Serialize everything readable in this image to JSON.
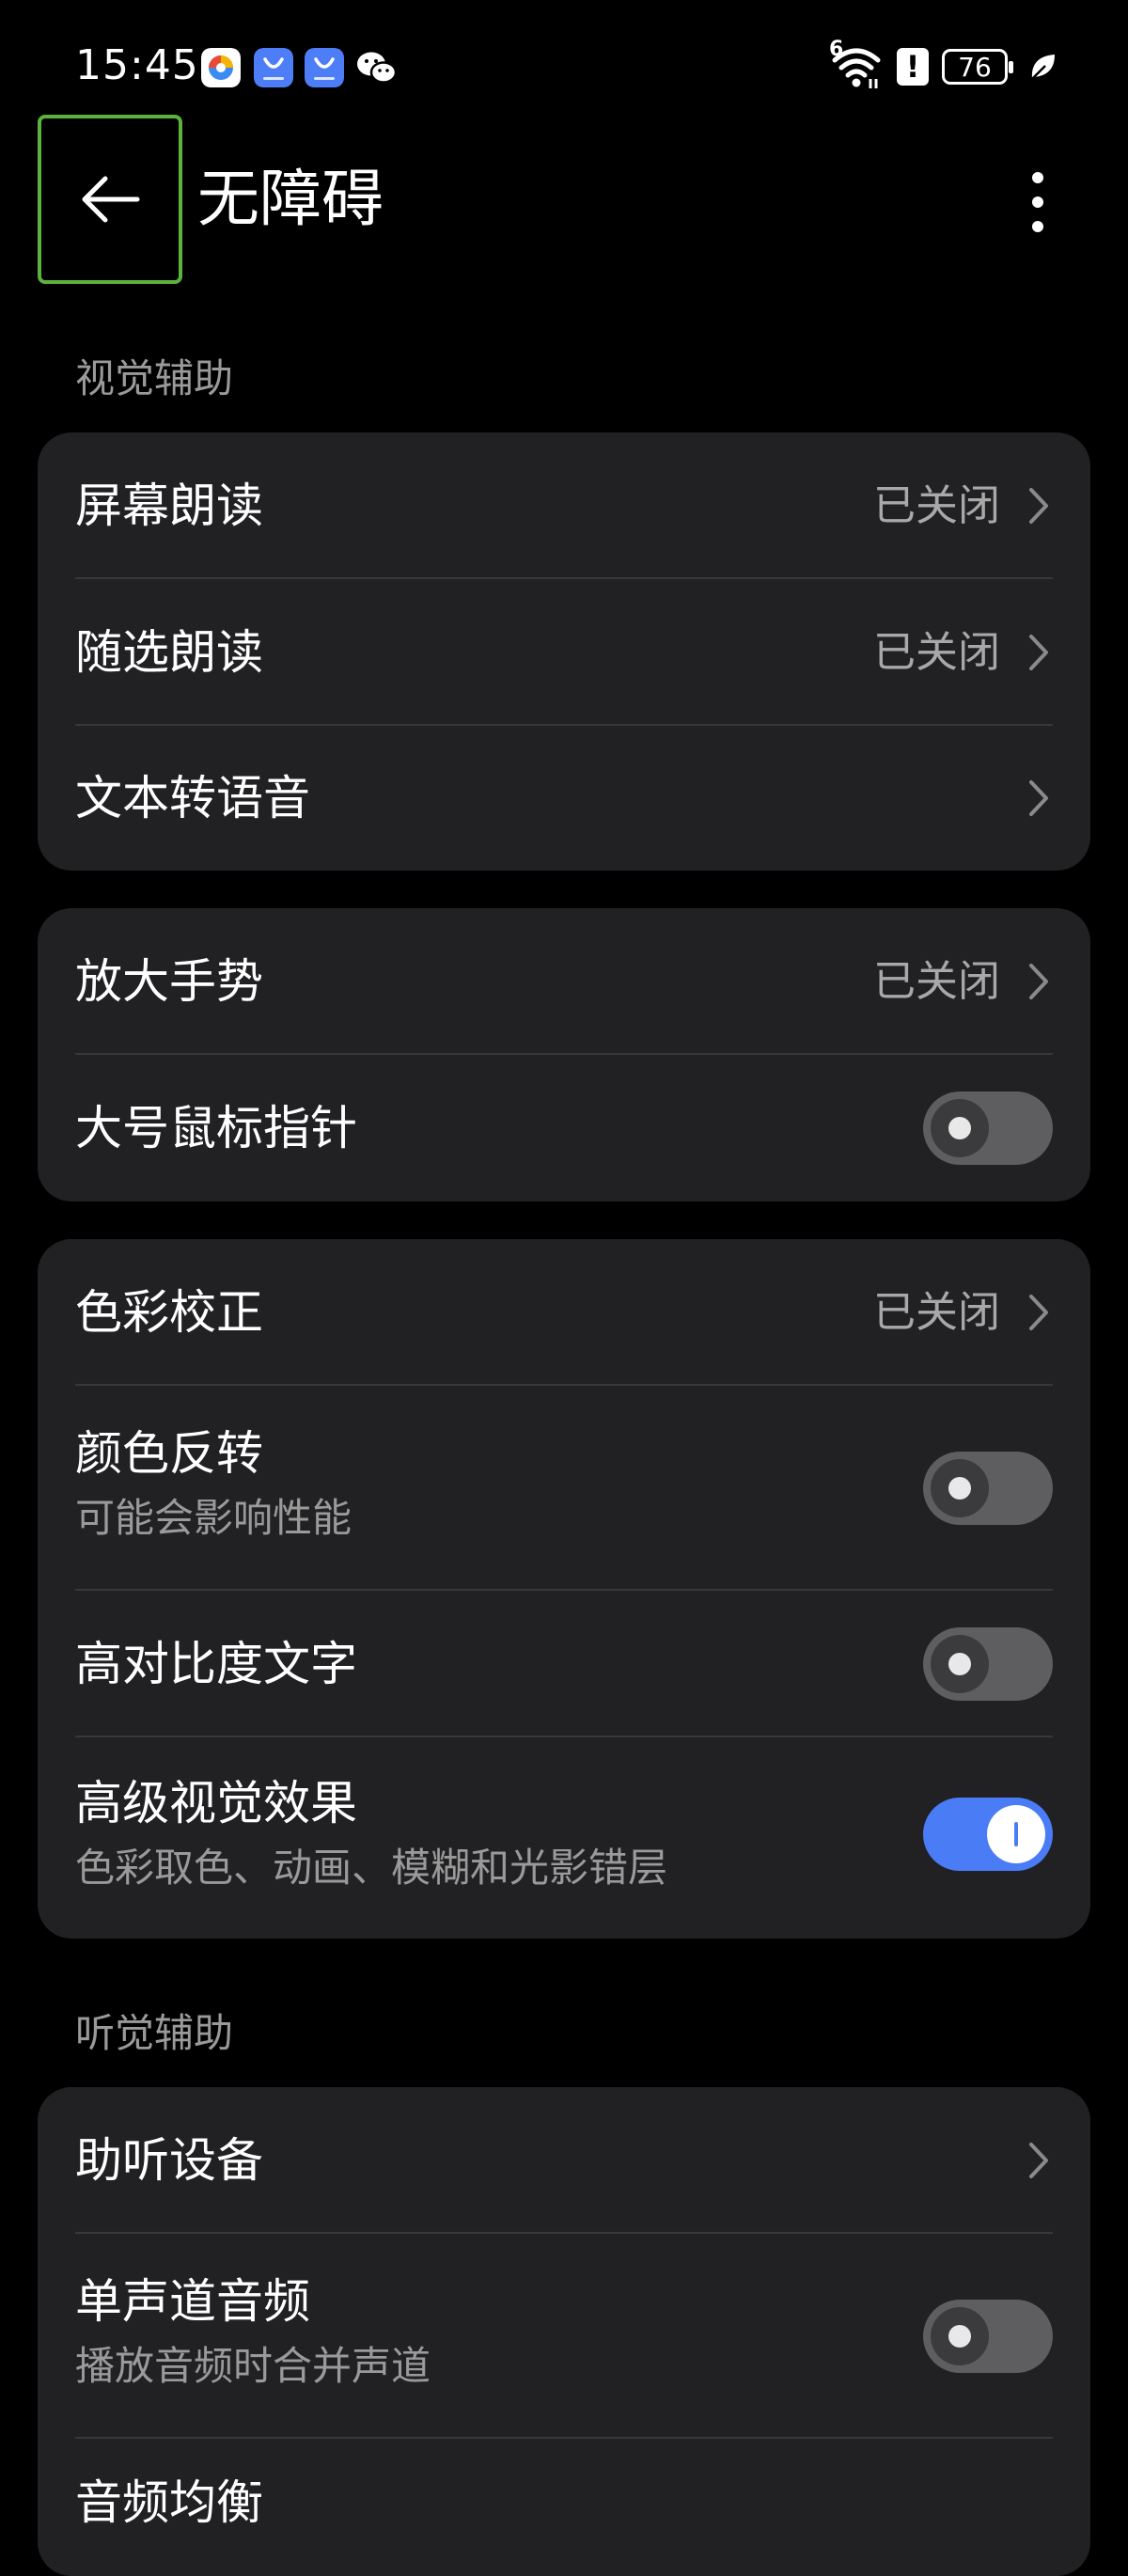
{
  "status_bar": {
    "time": "15:45",
    "network_badge": "6",
    "battery": "76",
    "alert": "!"
  },
  "header": {
    "title": "无障碍"
  },
  "sections": {
    "visual": {
      "title": "视觉辅助",
      "items": [
        {
          "label": "屏幕朗读",
          "value": "已关闭"
        },
        {
          "label": "随选朗读",
          "value": "已关闭"
        },
        {
          "label": "文本转语音"
        },
        {
          "label": "放大手势",
          "value": "已关闭"
        },
        {
          "label": "大号鼠标指针",
          "toggle": false
        },
        {
          "label": "色彩校正",
          "value": "已关闭"
        },
        {
          "label": "颜色反转",
          "subtitle": "可能会影响性能",
          "toggle": false
        },
        {
          "label": "高对比度文字",
          "toggle": false
        },
        {
          "label": "高级视觉效果",
          "subtitle": "色彩取色、动画、模糊和光影错层",
          "toggle": true
        }
      ]
    },
    "hearing": {
      "title": "听觉辅助",
      "items": [
        {
          "label": "助听设备"
        },
        {
          "label": "单声道音频",
          "subtitle": "播放音频时合并声道",
          "toggle": false
        },
        {
          "label": "音频均衡"
        }
      ]
    }
  },
  "colors": {
    "background": "#000000",
    "card": "#212124",
    "accent": "#4a7cf6",
    "toggle_off": "#5e5e60",
    "highlight_border": "#5cb23c"
  }
}
